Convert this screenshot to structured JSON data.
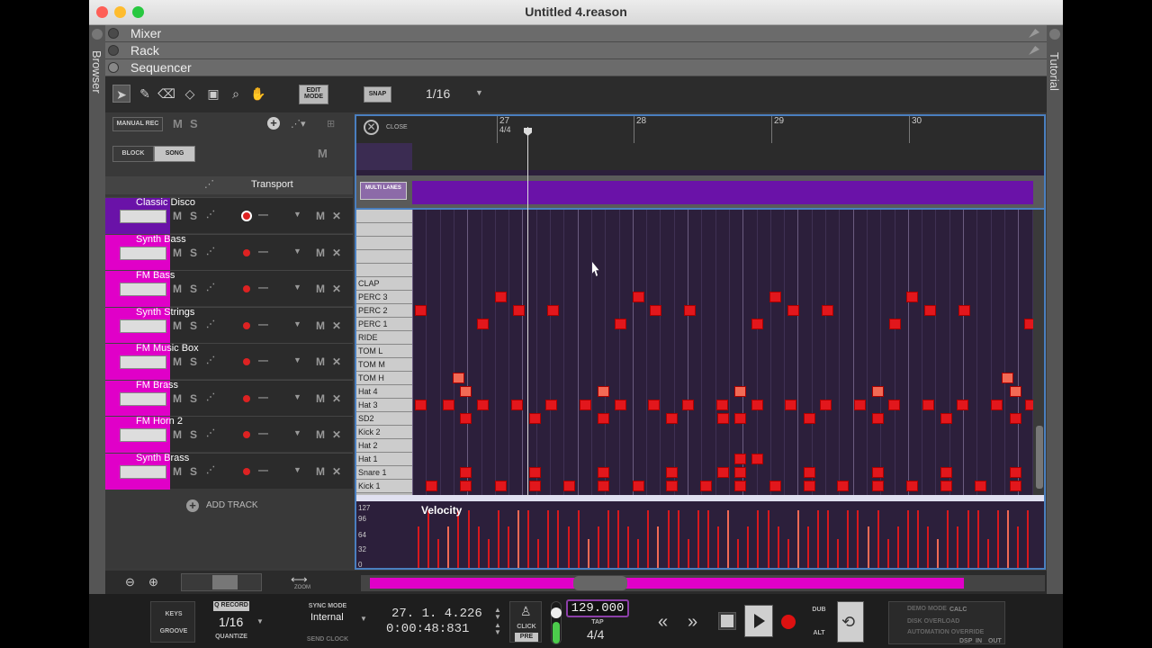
{
  "window": {
    "title": "Untitled 4.reason"
  },
  "sidebars": {
    "left": "Browser",
    "right": "Tutorial"
  },
  "panels": [
    "Mixer",
    "Rack",
    "Sequencer"
  ],
  "toolbar": {
    "edit_mode": "EDIT MODE",
    "snap": "SNAP",
    "snap_value": "1/16"
  },
  "tracklist": {
    "manual_rec": "MANUAL REC",
    "block": "BLOCK",
    "song": "SONG",
    "m": "M",
    "s": "S",
    "transport": "Transport",
    "add_track": "ADD TRACK",
    "tracks": [
      {
        "name": "Classic Disco"
      },
      {
        "name": "Synth Bass"
      },
      {
        "name": "FM Bass"
      },
      {
        "name": "Synth Strings"
      },
      {
        "name": "FM Music Box"
      },
      {
        "name": "FM Brass"
      },
      {
        "name": "FM Horn 2"
      },
      {
        "name": "Synth Brass"
      }
    ]
  },
  "editor": {
    "close": "CLOSE",
    "multi_lanes": "MULTI LANES",
    "ruler": [
      {
        "bar": "27",
        "sig": "4/4"
      },
      {
        "bar": "28"
      },
      {
        "bar": "29"
      },
      {
        "bar": "30"
      }
    ],
    "keys": [
      "CLAP",
      "PERC 3",
      "PERC 2",
      "PERC 1",
      "RIDE",
      "TOM L",
      "TOM M",
      "TOM H",
      "Hat 4",
      "Hat 3",
      "SD2",
      "Kick 2",
      "Hat 2",
      "Hat 1",
      "Snare 1",
      "Kick 1"
    ],
    "velocity_label": "Velocity",
    "velocity_ticks": [
      "127",
      "96",
      "64",
      "32",
      "0"
    ]
  },
  "transport": {
    "keys": "KEYS",
    "groove": "GROOVE",
    "q_record": "Q RECORD",
    "quantize_value": "1/16",
    "quantize": "QUANTIZE",
    "sync_mode": "SYNC MODE",
    "sync_value": "Internal",
    "send_clock": "SEND CLOCK",
    "position": "27. 1. 4.226",
    "time": "0:00:48:831",
    "click": "CLICK",
    "pre": "PRE",
    "tempo": "129.000",
    "tap": "TAP",
    "signature": "4/4",
    "dub": "DUB",
    "alt": "ALT",
    "demo_mode": "DEMO MODE",
    "disk_overload": "DISK OVERLOAD",
    "automation_override": "AUTOMATION OVERRIDE",
    "calc": "CALC",
    "dsp": "DSP",
    "in": "IN",
    "out": "OUT"
  },
  "colors": {
    "track": "#e000c8",
    "note": "#e2171c",
    "note_highlight": "#f26a55",
    "editor_bg": "#2c1f3b",
    "lane_purple": "#6a12a8"
  },
  "icons": [
    "arrow-icon",
    "pencil-icon",
    "eraser-icon",
    "razor-icon",
    "mute-icon",
    "magnifier-icon",
    "hand-icon",
    "close-icon",
    "zoom-in-icon",
    "zoom-out-icon",
    "rewind-icon",
    "fast-forward-icon",
    "stop-icon",
    "play-icon",
    "record-icon",
    "loop-icon",
    "metronome-icon"
  ]
}
